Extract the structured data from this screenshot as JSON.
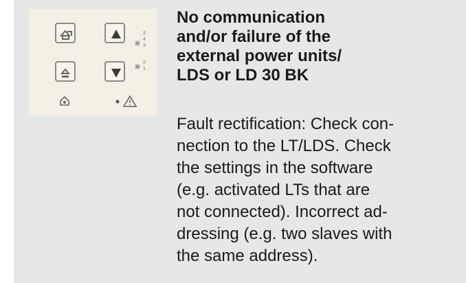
{
  "heading_lines": [
    "No communication",
    "and/or failure of the",
    "external power units/",
    "LDS or LD 30 BK"
  ],
  "body_lines": [
    "Fault rectification: Check con-",
    "nection to the LT/LDS. Check",
    "the settings in the software",
    "(e.g. activated LTs that are",
    "not connected). Incorrect ad-",
    "dressing (e.g. two slaves with",
    "the same address)."
  ],
  "panel": {
    "led_labels": [
      "3",
      "4",
      "3",
      "2",
      "1"
    ],
    "icons": [
      "home-arrow-icon",
      "eject-arrow-icon",
      "up-triangle-icon",
      "down-triangle-icon",
      "home-small-icon",
      "dot-icon",
      "warning-triangle-icon"
    ]
  },
  "colors": {
    "background": "#e6e8e7",
    "panel": "#f4f0e6",
    "key_border": "#8a8a88",
    "text": "#1a1a1a"
  }
}
